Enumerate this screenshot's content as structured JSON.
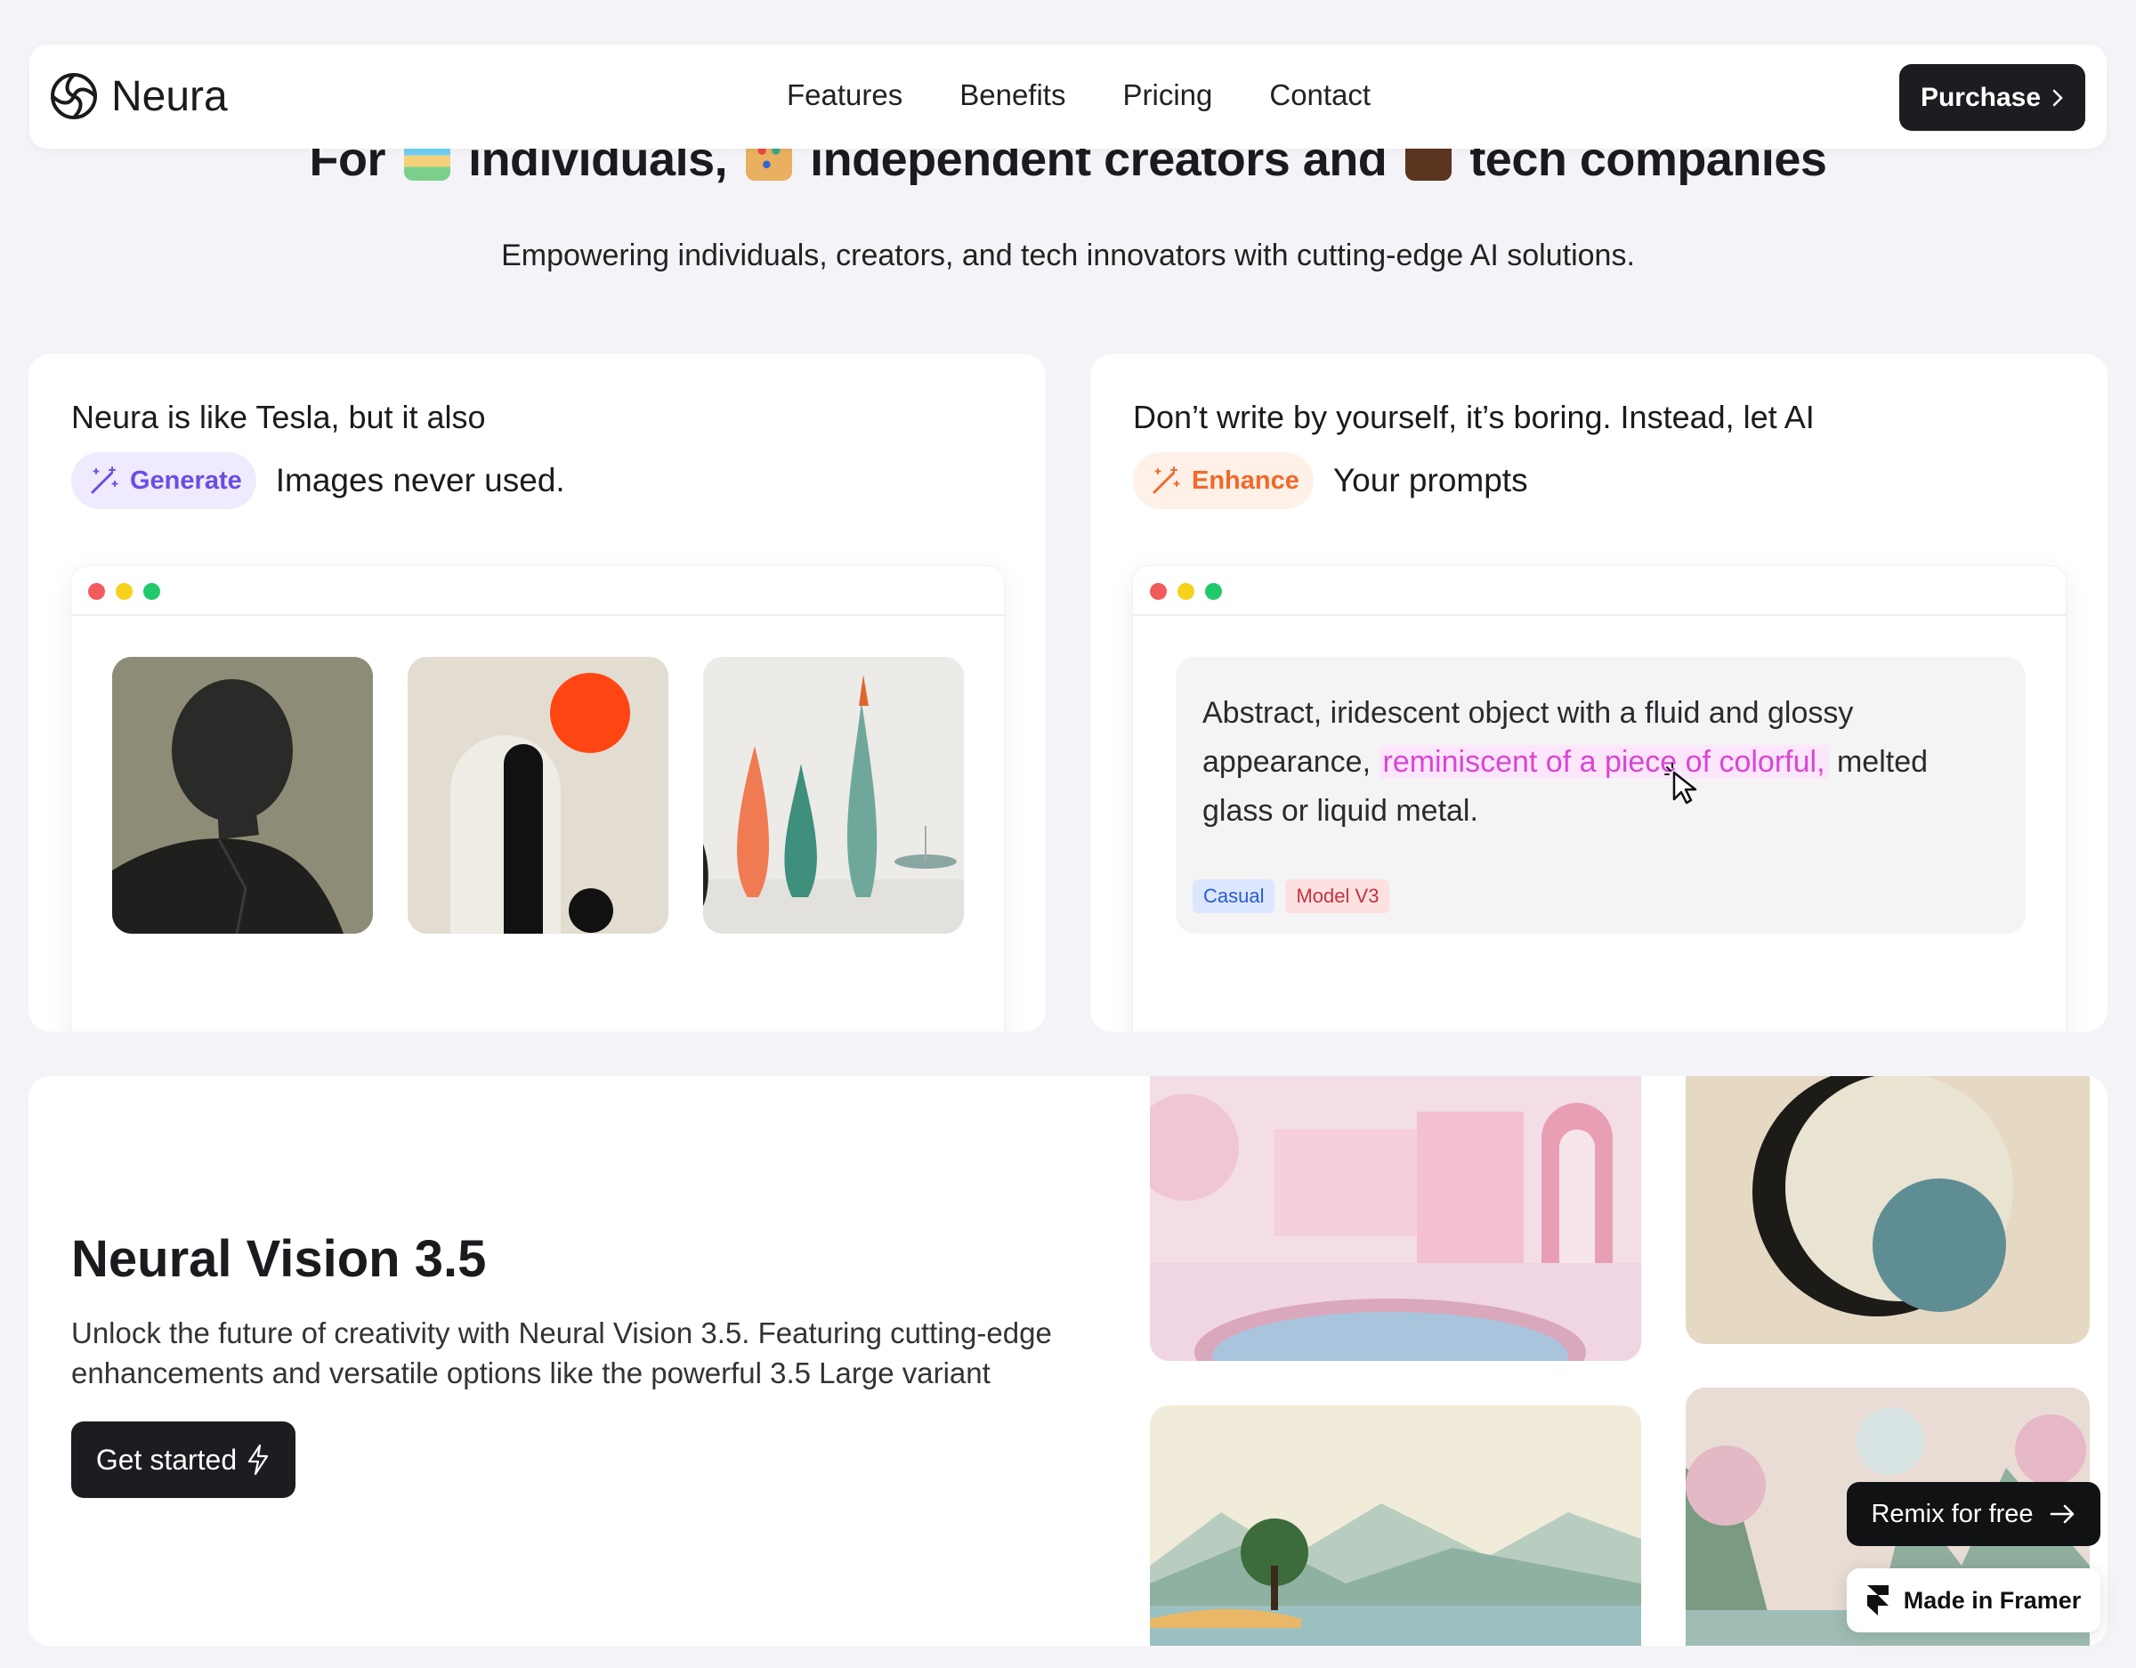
{
  "nav": {
    "brand": "Neura",
    "links": [
      "Features",
      "Benefits",
      "Pricing",
      "Contact"
    ],
    "purchase_label": "Purchase"
  },
  "hero": {
    "title_part1": "For",
    "title_part2": "individuals,",
    "title_part3": "independent creators and",
    "title_part4": "tech companies",
    "subtitle": "Empowering individuals, creators, and tech innovators with cutting-edge AI solutions."
  },
  "card_generate": {
    "line1": "Neura is like Tesla, but it also",
    "pill_label": "Generate",
    "line2": "Images never used."
  },
  "card_enhance": {
    "line1": "Don’t write by yourself, it’s boring. Instead, let AI",
    "pill_label": "Enhance",
    "line2": "Your prompts",
    "prompt_before": "Abstract, iridescent object with a fluid and glossy appearance, ",
    "prompt_highlight": "reminiscent of a piece of colorful,",
    "prompt_after": " melted glass or liquid metal.",
    "tags": [
      "Casual",
      "Model V3"
    ]
  },
  "vision": {
    "title": "Neural Vision 3.5",
    "description": "Unlock the future of creativity with Neural Vision 3.5. Featuring cutting-edge enhancements and versatile options like the powerful 3.5 Large variant",
    "cta_label": "Get started"
  },
  "badges": {
    "remix_label": "Remix for free",
    "framer_label": "Made in Framer"
  },
  "colors": {
    "background": "#f4f4f8",
    "dark_button": "#1b1d21",
    "generate_accent": "#6c4ce6",
    "enhance_accent": "#f06a2a",
    "highlight": "#d946d3"
  },
  "icons": [
    "neura-logo-icon",
    "chevron-right-icon",
    "magic-wand-icon",
    "cursor-icon",
    "lightning-icon",
    "arrow-right-icon",
    "framer-icon"
  ]
}
